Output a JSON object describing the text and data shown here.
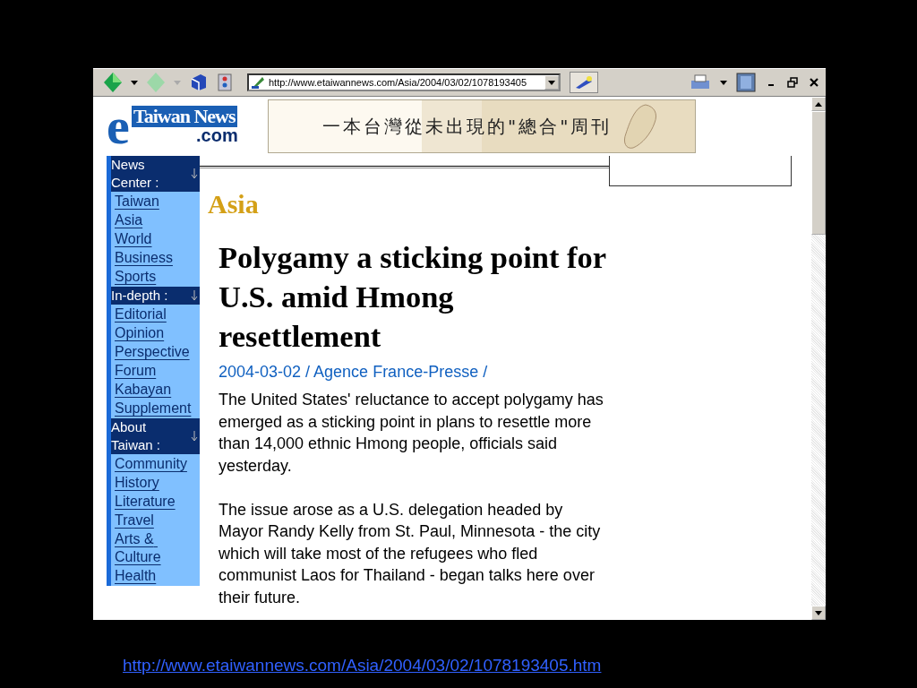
{
  "toolbar": {
    "address": "http://www.etaiwannews.com/Asia/2004/03/02/1078193405"
  },
  "logo": {
    "letter": "e",
    "name": "Taiwan News",
    "domain": ".com"
  },
  "banner": {
    "text": "一本台灣從未出現的\"總合\"周刊"
  },
  "sidebar": {
    "sections": [
      {
        "heading": "News Center :",
        "items": [
          "Taiwan",
          "Asia",
          "World",
          "Business",
          "Sports"
        ]
      },
      {
        "heading": "In-depth :",
        "items": [
          "Editorial",
          "Opinion",
          "Perspective",
          "Forum",
          "Kabayan",
          "Supplement"
        ]
      },
      {
        "heading": "About Taiwan :",
        "items": [
          "Community",
          "History",
          "Literature",
          "Travel",
          "Arts & Culture",
          "Health"
        ]
      }
    ]
  },
  "section_title": "Asia",
  "article": {
    "headline": "Polygamy a sticking point for U.S. amid Hmong resettlement",
    "byline": "2004-03-02 / Agence France-Presse /",
    "paragraphs": [
      "The United States' reluctance to accept polygamy has emerged as a sticking point in plans to resettle more than 14,000 ethnic Hmong people, officials said yesterday.",
      "The issue arose as a U.S. delegation headed by Mayor Randy Kelly from St. Paul, Minnesota - the city which will take most of the refugees who fled communist Laos for Thailand - began talks here over their future."
    ]
  },
  "slide_link": "http://www.etaiwannews.com/Asia/2004/03/02/1078193405.htm"
}
